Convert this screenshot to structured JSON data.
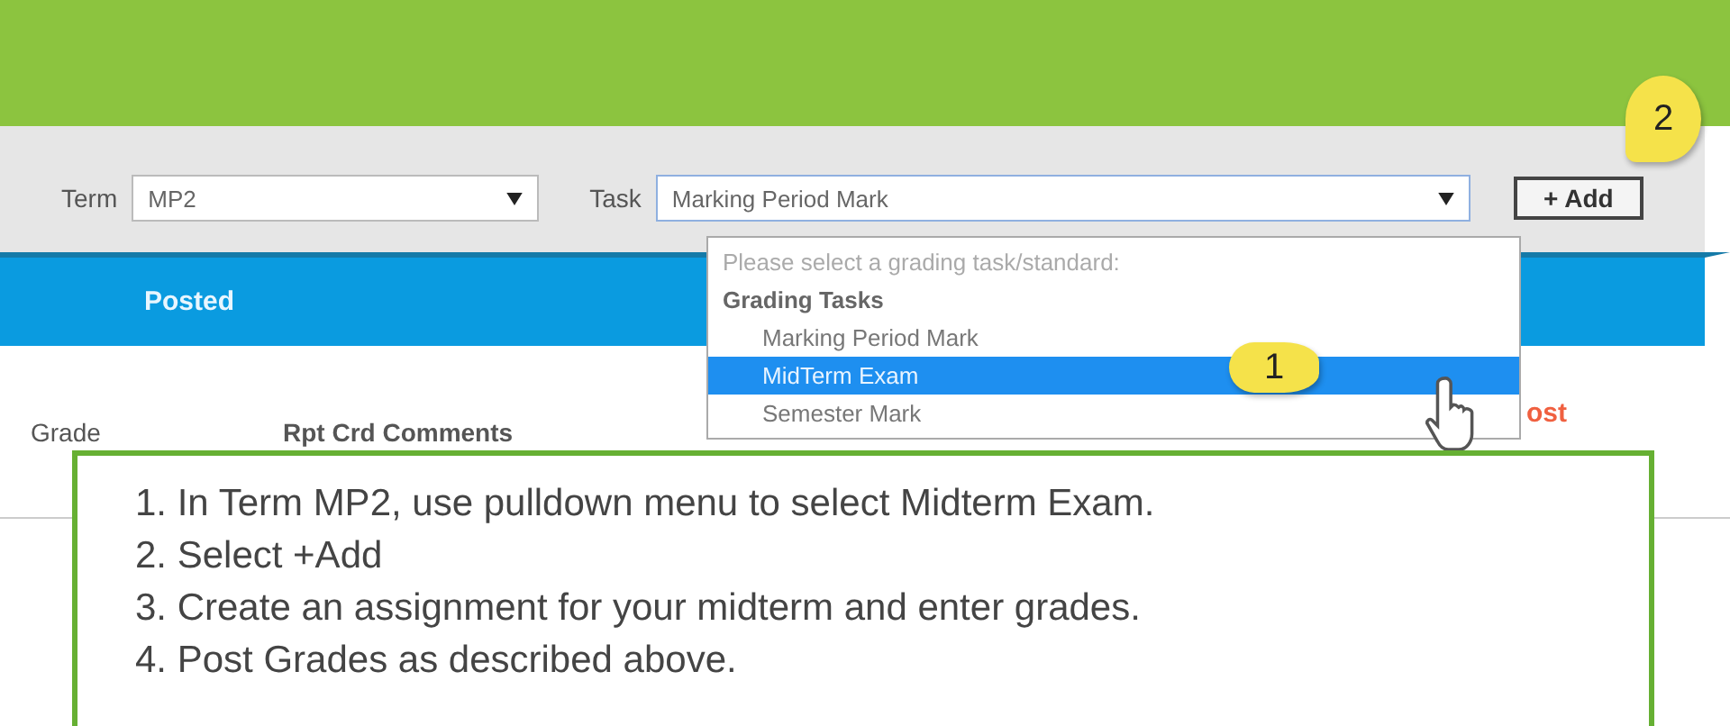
{
  "toolbar": {
    "term": {
      "label": "Term",
      "value": "MP2"
    },
    "task": {
      "label": "Task",
      "value": "Marking Period Mark"
    },
    "add_button": "+ Add"
  },
  "table": {
    "header": "Posted",
    "columns": [
      "Grade",
      "Rpt Crd Comments"
    ],
    "column_3": "ost"
  },
  "dropdown": {
    "placeholder": "Please select a grading task/standard:",
    "group": "Grading Tasks",
    "options": [
      {
        "label": "Marking Period Mark",
        "selected": false
      },
      {
        "label": "MidTerm Exam",
        "selected": true
      },
      {
        "label": "Semester Mark",
        "selected": false
      }
    ]
  },
  "callouts": [
    {
      "label": "1",
      "kind": "left"
    },
    {
      "label": "2",
      "kind": "down"
    }
  ],
  "instructions": [
    "1. In Term MP2, use pulldown menu to select Midterm Exam.",
    "2. Select +Add",
    "3. Create an assignment for your midterm and enter grades.",
    "4. Post Grades as described above."
  ]
}
